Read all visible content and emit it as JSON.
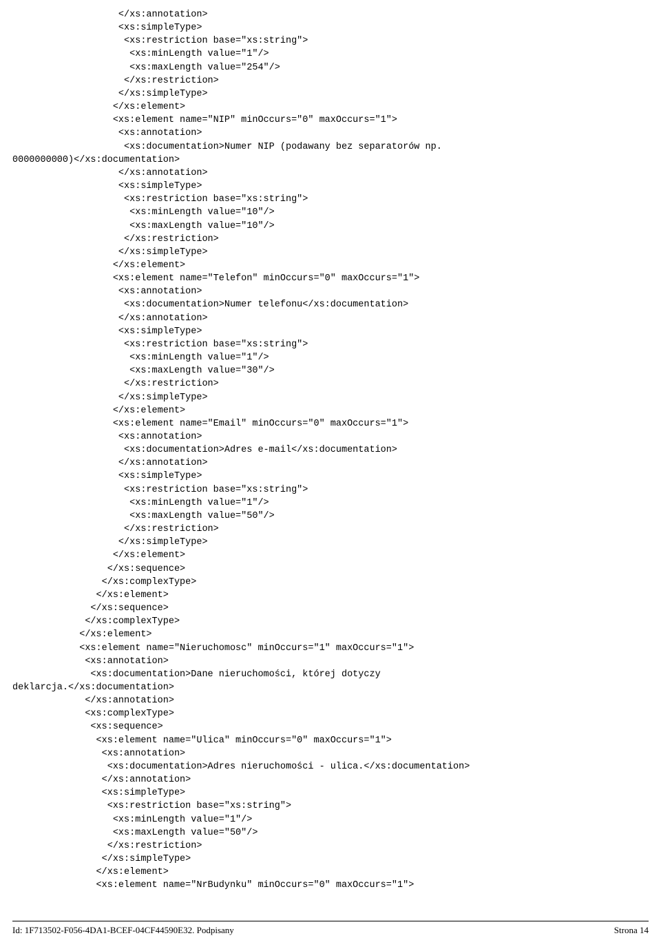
{
  "code": "                   </xs:annotation>\n                   <xs:simpleType>\n                    <xs:restriction base=\"xs:string\">\n                     <xs:minLength value=\"1\"/>\n                     <xs:maxLength value=\"254\"/>\n                    </xs:restriction>\n                   </xs:simpleType>\n                  </xs:element>\n                  <xs:element name=\"NIP\" minOccurs=\"0\" maxOccurs=\"1\">\n                   <xs:annotation>\n                    <xs:documentation>Numer NIP (podawany bez separatorów np.\n0000000000)</xs:documentation>\n                   </xs:annotation>\n                   <xs:simpleType>\n                    <xs:restriction base=\"xs:string\">\n                     <xs:minLength value=\"10\"/>\n                     <xs:maxLength value=\"10\"/>\n                    </xs:restriction>\n                   </xs:simpleType>\n                  </xs:element>\n                  <xs:element name=\"Telefon\" minOccurs=\"0\" maxOccurs=\"1\">\n                   <xs:annotation>\n                    <xs:documentation>Numer telefonu</xs:documentation>\n                   </xs:annotation>\n                   <xs:simpleType>\n                    <xs:restriction base=\"xs:string\">\n                     <xs:minLength value=\"1\"/>\n                     <xs:maxLength value=\"30\"/>\n                    </xs:restriction>\n                   </xs:simpleType>\n                  </xs:element>\n                  <xs:element name=\"Email\" minOccurs=\"0\" maxOccurs=\"1\">\n                   <xs:annotation>\n                    <xs:documentation>Adres e-mail</xs:documentation>\n                   </xs:annotation>\n                   <xs:simpleType>\n                    <xs:restriction base=\"xs:string\">\n                     <xs:minLength value=\"1\"/>\n                     <xs:maxLength value=\"50\"/>\n                    </xs:restriction>\n                   </xs:simpleType>\n                  </xs:element>\n                 </xs:sequence>\n                </xs:complexType>\n               </xs:element>\n              </xs:sequence>\n             </xs:complexType>\n            </xs:element>\n            <xs:element name=\"Nieruchomosc\" minOccurs=\"1\" maxOccurs=\"1\">\n             <xs:annotation>\n              <xs:documentation>Dane nieruchomości, której dotyczy\ndeklarcja.</xs:documentation>\n             </xs:annotation>\n             <xs:complexType>\n              <xs:sequence>\n               <xs:element name=\"Ulica\" minOccurs=\"0\" maxOccurs=\"1\">\n                <xs:annotation>\n                 <xs:documentation>Adres nieruchomości - ulica.</xs:documentation>\n                </xs:annotation>\n                <xs:simpleType>\n                 <xs:restriction base=\"xs:string\">\n                  <xs:minLength value=\"1\"/>\n                  <xs:maxLength value=\"50\"/>\n                 </xs:restriction>\n                </xs:simpleType>\n               </xs:element>\n               <xs:element name=\"NrBudynku\" minOccurs=\"0\" maxOccurs=\"1\">",
  "footer": {
    "left": "Id: 1F713502-F056-4DA1-BCEF-04CF44590E32. Podpisany",
    "right": "Strona 14"
  }
}
